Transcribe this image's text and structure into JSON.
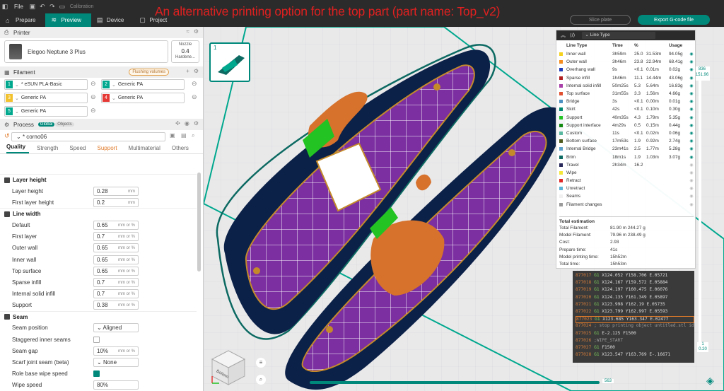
{
  "app": {
    "menu_file": "File",
    "doc_title": "Calibration",
    "tabs": [
      "Prepare",
      "Preview",
      "Device",
      "Project"
    ],
    "active_tab": "Preview",
    "slice_button": "Slice plate",
    "export_button": "Export G-code file",
    "accent_color": "#00897b"
  },
  "caption": "An alternative printing option for the top part (part name: Top_v2)",
  "printer": {
    "section": "Printer",
    "name": "Elegoo Neptune 3 Plus",
    "nozzle_label": "Nozzle",
    "nozzle_value": "0.4",
    "nozzle_type": "Hardene..."
  },
  "filament": {
    "section": "Filament",
    "flushing_label": "Flushing volumes",
    "slots": [
      {
        "num": "1",
        "name": "* eSUN PLA-Basic",
        "color": "#00a88e"
      },
      {
        "num": "2",
        "name": "Generic PA",
        "color": "#00a88e"
      },
      {
        "num": "3",
        "name": "Generic PA",
        "color": "#f2c12e"
      },
      {
        "num": "4",
        "name": "Generic PA",
        "color": "#e53935"
      },
      {
        "num": "5",
        "name": "Generic PA",
        "color": "#00a88e"
      }
    ]
  },
  "process": {
    "section": "Process",
    "tag_global": "Global",
    "tag_objects": "Objects",
    "preset": "* corno06",
    "tabs": [
      "Quality",
      "Strength",
      "Speed",
      "Support",
      "Multimaterial",
      "Others"
    ],
    "groups": {
      "layer_height": {
        "title": "Layer height",
        "rows": [
          {
            "label": "Layer height",
            "value": "0.28",
            "unit": "mm"
          },
          {
            "label": "First layer height",
            "value": "0.2",
            "unit": "mm"
          }
        ]
      },
      "line_width": {
        "title": "Line width",
        "rows": [
          {
            "label": "Default",
            "value": "0.65",
            "unit": "mm or %"
          },
          {
            "label": "First layer",
            "value": "0.7",
            "unit": "mm or %"
          },
          {
            "label": "Outer wall",
            "value": "0.65",
            "unit": "mm or %"
          },
          {
            "label": "Inner wall",
            "value": "0.65",
            "unit": "mm or %"
          },
          {
            "label": "Top surface",
            "value": "0.65",
            "unit": "mm or %"
          },
          {
            "label": "Sparse infill",
            "value": "0.7",
            "unit": "mm or %"
          },
          {
            "label": "Internal solid infill",
            "value": "0.7",
            "unit": "mm or %"
          },
          {
            "label": "Support",
            "value": "0.38",
            "unit": "mm or %"
          }
        ]
      },
      "seam": {
        "title": "Seam",
        "rows": [
          {
            "label": "Seam position",
            "value": "Aligned"
          },
          {
            "label": "Staggered inner seams"
          },
          {
            "label": "Seam gap",
            "value": "10%",
            "unit": "mm or %"
          },
          {
            "label": "Scarf joint seam (beta)",
            "value": "None"
          },
          {
            "label": "Role base wipe speed"
          },
          {
            "label": "Wipe speed",
            "value": "80%"
          }
        ]
      }
    }
  },
  "legend": {
    "selector": "Line Type",
    "headers": [
      "Line Type",
      "Time",
      "%",
      "Usage"
    ],
    "rows": [
      {
        "name": "Inner wall",
        "time": "3h59m",
        "pct": "25.0",
        "len": "31.53m",
        "use": "94.05g",
        "color": "#f5d21e"
      },
      {
        "name": "Outer wall",
        "time": "3h46m",
        "pct": "23.8",
        "len": "22.94m",
        "use": "68.41g",
        "color": "#f58c1e"
      },
      {
        "name": "Overhang wall",
        "time": "9s",
        "pct": "<0.1",
        "len": "0.01m",
        "use": "0.02g",
        "color": "#1f3cba"
      },
      {
        "name": "Sparse infill",
        "time": "1h46m",
        "pct": "11.1",
        "len": "14.44m",
        "use": "43.06g",
        "color": "#b02020"
      },
      {
        "name": "Internal solid infill",
        "time": "50m25s",
        "pct": "5.3",
        "len": "5.64m",
        "use": "16.83g",
        "color": "#a83ea8"
      },
      {
        "name": "Top surface",
        "time": "31m55s",
        "pct": "3.3",
        "len": "1.56m",
        "use": "4.66g",
        "color": "#e05030"
      },
      {
        "name": "Bridge",
        "time": "3s",
        "pct": "<0.1",
        "len": "0.00m",
        "use": "0.01g",
        "color": "#4a90c0"
      },
      {
        "name": "Skirt",
        "time": "42s",
        "pct": "<0.1",
        "len": "0.10m",
        "use": "0.30g",
        "color": "#00876e"
      },
      {
        "name": "Support",
        "time": "40m35s",
        "pct": "4.3",
        "len": "1.79m",
        "use": "5.35g",
        "color": "#22c322"
      },
      {
        "name": "Support interface",
        "time": "4m29s",
        "pct": "0.5",
        "len": "0.15m",
        "use": "0.44g",
        "color": "#128a12"
      },
      {
        "name": "Custom",
        "time": "11s",
        "pct": "<0.1",
        "len": "0.02m",
        "use": "0.06g",
        "color": "#58b8a0"
      },
      {
        "name": "Bottom surface",
        "time": "17m53s",
        "pct": "1.9",
        "len": "0.92m",
        "use": "2.74g",
        "color": "#4e5a1e"
      },
      {
        "name": "Internal Bridge",
        "time": "23m41s",
        "pct": "2.5",
        "len": "1.77m",
        "use": "5.28g",
        "color": "#5aa0c8"
      },
      {
        "name": "Brim",
        "time": "18m1s",
        "pct": "1.9",
        "len": "1.03m",
        "use": "3.07g",
        "color": "#0c6a62"
      },
      {
        "name": "Travel",
        "time": "2h34m",
        "pct": "16.2",
        "len": "",
        "use": "",
        "color": "#28285a"
      },
      {
        "name": "Wipe",
        "time": "",
        "pct": "",
        "len": "",
        "use": "",
        "color": "#f5e63a"
      },
      {
        "name": "Retract",
        "time": "",
        "pct": "",
        "len": "",
        "use": "",
        "color": "#e02828"
      },
      {
        "name": "Unretract",
        "time": "",
        "pct": "",
        "len": "",
        "use": "",
        "color": "#5bb4d8"
      },
      {
        "name": "Seams",
        "time": "",
        "pct": "",
        "len": "",
        "use": "",
        "color": "#f0f0f0"
      },
      {
        "name": "Filament changes",
        "time": "",
        "pct": "",
        "len": "",
        "use": "",
        "color": "#9a9a9a"
      }
    ]
  },
  "estimation": {
    "title": "Total estimation",
    "rows": [
      {
        "label": "Total Filament:",
        "value": "81.90 m    244.27 g"
      },
      {
        "label": "Model Filament:",
        "value": "79.96 m    238.49 g"
      },
      {
        "label": "Cost:",
        "value": "2.93"
      },
      {
        "label": "Prepare time:",
        "value": "41s"
      },
      {
        "label": "Model printing time:",
        "value": "15h52m"
      },
      {
        "label": "Total time:",
        "value": "15h53m"
      }
    ]
  },
  "gcode": [
    {
      "ln": "877017",
      "cmd": "G1",
      "args": "X124.052 Y158.706 E.05721"
    },
    {
      "ln": "877018",
      "cmd": "G1",
      "args": "X124.167 Y159.572 E.05884"
    },
    {
      "ln": "877019",
      "cmd": "G1",
      "args": "X124.197 Y160.475 E.06076"
    },
    {
      "ln": "877020",
      "cmd": "G1",
      "args": "X124.135 Y161.349 E.05897"
    },
    {
      "ln": "877021",
      "cmd": "G1",
      "args": "X123.998 Y162.19 E.05735"
    },
    {
      "ln": "877022",
      "cmd": "G1",
      "args": "X123.799 Y162.997 E.05593"
    },
    {
      "ln": "877023",
      "cmd": "G1",
      "args": "X123.685 Y163.347 E.02477"
    },
    {
      "ln": "877024",
      "cmd": "",
      "args": "; stop printing object untitled.stl id:0 copy 0"
    },
    {
      "ln": "877025",
      "cmd": "G1",
      "args": "E-2.125 F1500"
    },
    {
      "ln": "877026",
      "cmd": "",
      "args": ";WIPE_START"
    },
    {
      "ln": "877027",
      "cmd": "G1",
      "args": "F1500"
    },
    {
      "ln": "877028",
      "cmd": "G1",
      "args": "X123.547 Y163.769 E-.16671"
    }
  ],
  "viewport": {
    "plate_number": "1",
    "layer_top": "836",
    "layer_top_height": "151.96",
    "layer_bottom": "1",
    "layer_bottom_height": "0.20",
    "move_value": "563",
    "nav_cube_label": "Bottom"
  }
}
